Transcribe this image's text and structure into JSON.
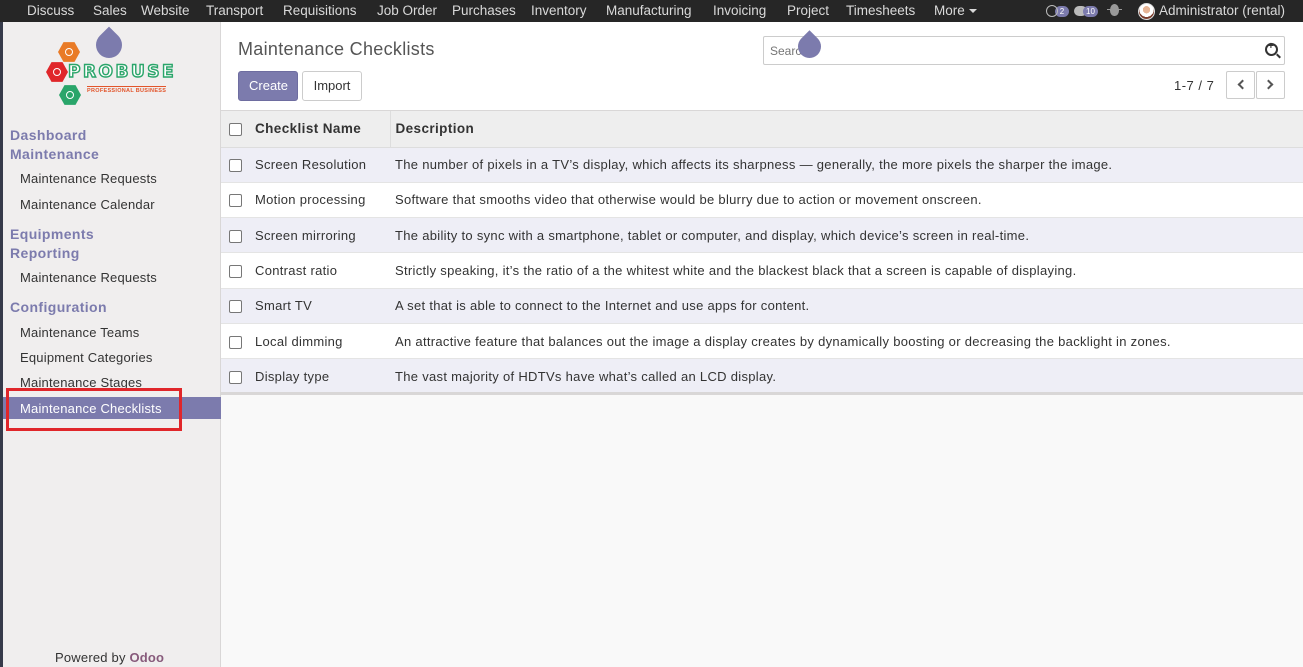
{
  "topbar": {
    "menu": [
      "Discuss",
      "Sales",
      "Website",
      "Transport",
      "Requisitions",
      "Job Order",
      "Purchases",
      "Inventory",
      "Manufacturing",
      "Invoicing",
      "Project",
      "Timesheets"
    ],
    "more_label": "More",
    "activity_count": "2",
    "message_count": "10",
    "user_name": "Administrator (rental)"
  },
  "sidebar": {
    "logo_text": "PROBUSE",
    "logo_subtext": "PROFESSIONAL BUSINESS",
    "sections": [
      {
        "title": "Dashboard"
      },
      {
        "title": "Maintenance",
        "items": [
          "Maintenance Requests",
          "Maintenance Calendar"
        ]
      },
      {
        "title": "Equipments"
      },
      {
        "title": "Reporting",
        "items": [
          "Maintenance Requests"
        ]
      },
      {
        "title": "Configuration",
        "items": [
          "Maintenance Teams",
          "Equipment Categories",
          "Maintenance Stages",
          "Maintenance Checklists"
        ]
      }
    ],
    "active_item": "Maintenance Checklists",
    "powered_prefix": "Powered by",
    "powered_brand": "Odoo"
  },
  "main": {
    "title": "Maintenance Checklists",
    "create_label": "Create",
    "import_label": "Import",
    "search_placeholder": "Search...",
    "pager_text": "1-7 / 7"
  },
  "table": {
    "columns": [
      "Checklist Name",
      "Description"
    ],
    "rows": [
      {
        "name": "Screen Resolution",
        "description": "The number of pixels in a TV’s display, which affects its sharpness — generally, the more pixels the sharper the image."
      },
      {
        "name": "Motion processing",
        "description": "Software that smooths video that otherwise would be blurry due to action or movement onscreen."
      },
      {
        "name": "Screen mirroring",
        "description": "The ability to sync with a smartphone, tablet or computer, and display, which device’s screen in real-time."
      },
      {
        "name": "Contrast ratio",
        "description": "Strictly speaking, it’s the ratio of a the whitest white and the blackest black that a screen is capable of displaying."
      },
      {
        "name": "Smart TV",
        "description": "A set that is able to connect to the Internet and use apps for content."
      },
      {
        "name": "Local dimming",
        "description": "An attractive feature that balances out the image a display creates by dynamically boosting or decreasing the backlight in zones."
      },
      {
        "name": "Display type",
        "description": "The vast majority of HDTVs have what’s called an LCD display."
      }
    ]
  },
  "colors": {
    "accent": "#7c7bad",
    "topbar": "#262626",
    "highlight": "#e0262a",
    "brand_green": "#2aa56a"
  }
}
